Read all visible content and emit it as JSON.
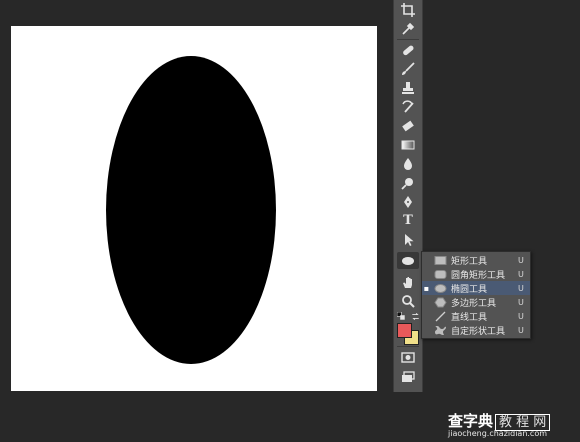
{
  "toolbar": {
    "tools": [
      {
        "name": "crop-tool",
        "icon": "crop-icon"
      },
      {
        "name": "eyedropper-tool",
        "icon": "eyedropper-icon"
      },
      {
        "name": "spot-healing-tool",
        "icon": "bandage-icon"
      },
      {
        "name": "brush-tool",
        "icon": "brush-icon"
      },
      {
        "name": "clone-stamp-tool",
        "icon": "stamp-icon"
      },
      {
        "name": "history-brush-tool",
        "icon": "history-brush-icon"
      },
      {
        "name": "eraser-tool",
        "icon": "eraser-icon"
      },
      {
        "name": "gradient-tool",
        "icon": "gradient-icon"
      },
      {
        "name": "blur-tool",
        "icon": "blur-icon"
      },
      {
        "name": "dodge-tool",
        "icon": "dodge-icon"
      },
      {
        "name": "pen-tool",
        "icon": "pen-icon"
      },
      {
        "name": "type-tool",
        "icon": "type-icon",
        "glyph": "T"
      },
      {
        "name": "path-selection-tool",
        "icon": "arrow-icon"
      },
      {
        "name": "ellipse-tool",
        "icon": "ellipse-icon",
        "active": true
      },
      {
        "name": "hand-tool",
        "icon": "hand-icon"
      },
      {
        "name": "zoom-tool",
        "icon": "zoom-icon"
      }
    ],
    "foreground_color": "#e8595a",
    "background_color": "#f1e08a"
  },
  "shape_flyout": {
    "items": [
      {
        "label": "矩形工具",
        "shortcut": "U",
        "icon": "rectangle-icon",
        "selected": false
      },
      {
        "label": "圆角矩形工具",
        "shortcut": "U",
        "icon": "rounded-rectangle-icon",
        "selected": false
      },
      {
        "label": "椭圆工具",
        "shortcut": "U",
        "icon": "ellipse-icon",
        "selected": true,
        "marker": "▪"
      },
      {
        "label": "多边形工具",
        "shortcut": "U",
        "icon": "polygon-icon",
        "selected": false
      },
      {
        "label": "直线工具",
        "shortcut": "U",
        "icon": "line-icon",
        "selected": false
      },
      {
        "label": "自定形状工具",
        "shortcut": "U",
        "icon": "custom-shape-icon",
        "selected": false
      }
    ]
  },
  "watermark": {
    "title": "查字典",
    "box": "教 程 网",
    "url": "jiaocheng.chazidian.com"
  },
  "colors": {
    "workspace": "#282828",
    "panel": "#535353",
    "selection": "#4a5a74",
    "ellipse_fill": "#000000"
  }
}
